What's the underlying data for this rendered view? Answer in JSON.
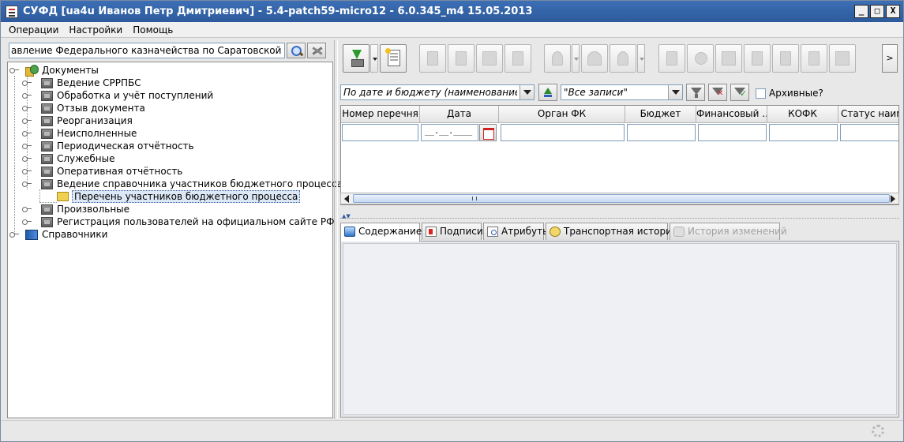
{
  "window": {
    "title": "СУФД [ua4u Иванов Петр Дмитриевич] - 5.4-patch59-micro12 - 6.0.345_m4 15.05.2013",
    "controls": {
      "minimize": "_",
      "maximize": "□",
      "close": "X"
    }
  },
  "menu": [
    "Операции",
    "Настройки",
    "Помощь"
  ],
  "left": {
    "search_value": "авление Федерального казначейства по Саратовской области",
    "tree": {
      "documents": "Документы",
      "items": [
        "Ведение СРРПБС",
        "Обработка и учёт поступлений",
        "Отзыв документа",
        "Реорганизация",
        "Неисполненные",
        "Периодическая отчётность",
        "Служебные",
        "Оперативная отчётность",
        "Ведение справочника участников бюджетного процесса"
      ],
      "child": "Перечень участников бюджетного процесса",
      "items_after": [
        "Произвольные",
        "Регистрация пользователей на официальном сайте РФ"
      ],
      "references": "Справочники"
    }
  },
  "toolbar": {
    "more_label": ">"
  },
  "filters": {
    "sort_combo": "По дате и бюджету (наименование)",
    "records_combo": "\"Все записи\"",
    "archived_label": "Архивные?",
    "archived_checked": false
  },
  "grid": {
    "columns": [
      "Номер перечня",
      "Дата",
      "Орган ФК",
      "Бюджет",
      "Финансовый ...",
      "КОФК",
      "Статус наиме"
    ],
    "date_mask": "__.__.____"
  },
  "tabs": [
    {
      "label": "Содержание",
      "active": true,
      "enabled": true
    },
    {
      "label": "Подписи",
      "active": false,
      "enabled": true
    },
    {
      "label": "Атрибуты",
      "active": false,
      "enabled": true
    },
    {
      "label": "Транспортная история",
      "active": false,
      "enabled": true
    },
    {
      "label": "История изменений",
      "active": false,
      "enabled": false
    }
  ]
}
